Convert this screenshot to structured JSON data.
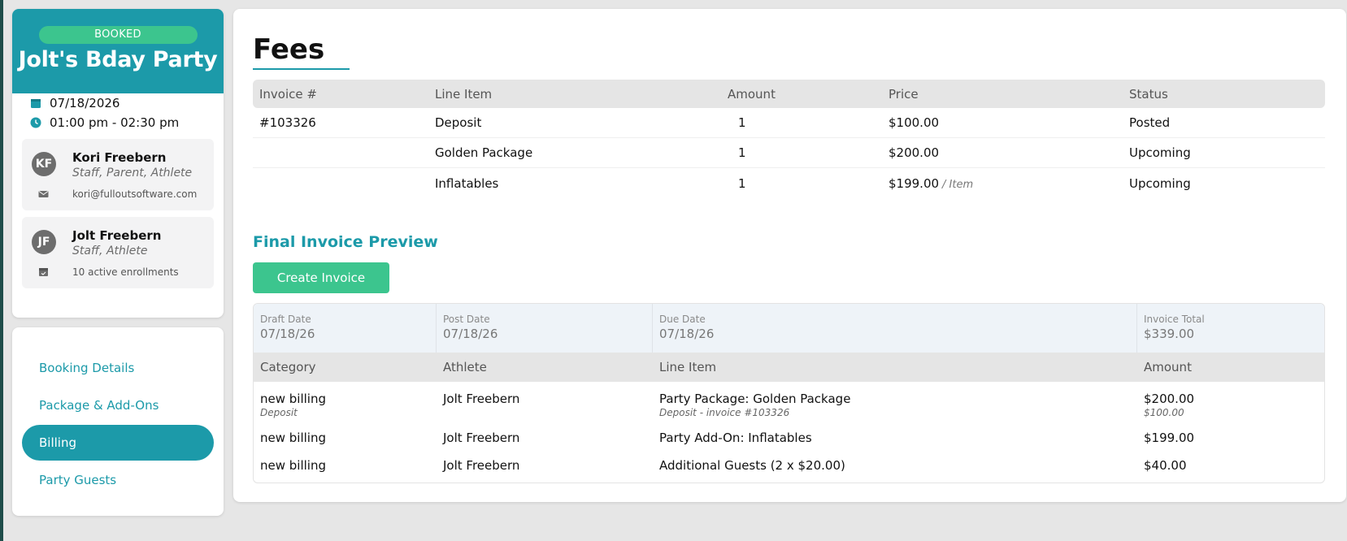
{
  "booking": {
    "status": "BOOKED",
    "title": "Jolt's Bday Party",
    "date": "07/18/2026",
    "time": "01:00 pm - 02:30 pm",
    "people": [
      {
        "initials": "KF",
        "name": "Kori Freebern",
        "roles": "Staff, Parent, Athlete",
        "detail": "kori@fulloutsoftware.com",
        "detail_icon": "mail-icon"
      },
      {
        "initials": "JF",
        "name": "Jolt Freebern",
        "roles": "Staff, Athlete",
        "detail": "10 active enrollments",
        "detail_icon": "enrollment-icon"
      }
    ]
  },
  "nav": {
    "items": [
      {
        "label": "Booking Details",
        "active": false
      },
      {
        "label": "Package & Add-Ons",
        "active": false
      },
      {
        "label": "Billing",
        "active": true
      },
      {
        "label": "Party Guests",
        "active": false
      }
    ]
  },
  "fees": {
    "title": "Fees",
    "headers": {
      "invoice": "Invoice #",
      "line_item": "Line Item",
      "amount": "Amount",
      "price": "Price",
      "status": "Status"
    },
    "rows": [
      {
        "invoice": "#103326",
        "line_item": "Deposit",
        "amount": "1",
        "price": "$100.00",
        "unit": "",
        "status": "Posted"
      },
      {
        "invoice": "",
        "line_item": "Golden Package",
        "amount": "1",
        "price": "$200.00",
        "unit": "",
        "status": "Upcoming"
      },
      {
        "invoice": "",
        "line_item": "Inflatables",
        "amount": "1",
        "price": "$199.00",
        "unit": "/ Item",
        "status": "Upcoming"
      }
    ]
  },
  "preview": {
    "title": "Final Invoice Preview",
    "create_label": "Create Invoice",
    "dates": {
      "draft_label": "Draft Date",
      "draft": "07/18/26",
      "post_label": "Post Date",
      "post": "07/18/26",
      "due_label": "Due Date",
      "due": "07/18/26",
      "total_label": "Invoice Total",
      "total": "$339.00"
    },
    "headers": {
      "category": "Category",
      "athlete": "Athlete",
      "line_item": "Line Item",
      "amount": "Amount"
    },
    "rows": [
      {
        "category": "new billing",
        "category_sub": "Deposit",
        "athlete": "Jolt Freebern",
        "line_item": "Party Package: Golden Package",
        "line_sub": "Deposit - invoice #103326",
        "amount": "$200.00",
        "amount_sub": "$100.00"
      },
      {
        "category": "new billing",
        "athlete": "Jolt Freebern",
        "line_item": "Party Add-On: Inflatables",
        "amount": "$199.00"
      },
      {
        "category": "new billing",
        "athlete": "Jolt Freebern",
        "line_item": "Additional Guests (2 x $20.00)",
        "amount": "$40.00"
      }
    ]
  },
  "colors": {
    "brand": "#1c9aa9",
    "success": "#3cc58e"
  }
}
